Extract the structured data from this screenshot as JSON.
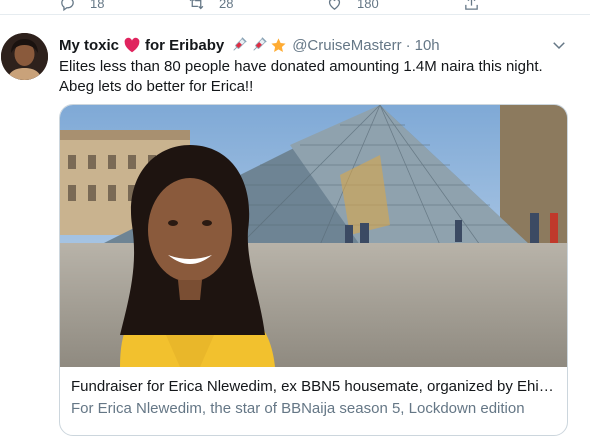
{
  "previous_tweet_actions": {
    "reply_count": "18",
    "retweet_count": "28",
    "like_count": "180"
  },
  "tweet": {
    "author_name": "My toxic",
    "author_name_suffix": "for Eribaby",
    "handle": "@CruiseMasterr",
    "separator": "·",
    "time": "10h",
    "text": "Elites less than 80 people have donated amounting 1.4M naira this night. Abeg lets do better for Erica!!",
    "icons": [
      "red-heart-icon",
      "syringe-icon",
      "syringe-icon",
      "star-icon",
      "chevron-down-icon"
    ]
  },
  "card": {
    "title": "Fundraiser for Erica Nlewedim, ex BBN5 housemate, organized by Ehizo...",
    "description": "For Erica Nlewedim, the star of BBNaija season 5, Lockdown edition"
  },
  "colors": {
    "heart": "#e0245e",
    "secondary_text": "#657786",
    "border": "#ccd6dd"
  }
}
